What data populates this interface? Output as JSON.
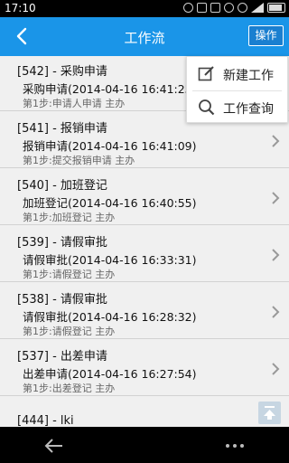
{
  "status_bar": {
    "time": "17:10"
  },
  "header": {
    "title": "工作流",
    "action_label": "操作"
  },
  "menu": {
    "items": [
      {
        "label": "新建工作",
        "icon": "edit-icon"
      },
      {
        "label": "工作查询",
        "icon": "search-icon"
      }
    ]
  },
  "list": {
    "items": [
      {
        "title": "[542]  -  采购申请",
        "subtitle": "采购申请(2014-04-16 16:41:25)",
        "step": "第1步:申请人申请 主办"
      },
      {
        "title": "[541]  -  报销申请",
        "subtitle": "报销申请(2014-04-16 16:41:09)",
        "step": "第1步:提交报销申请 主办"
      },
      {
        "title": "[540]  -  加班登记",
        "subtitle": "加班登记(2014-04-16 16:40:55)",
        "step": "第1步:加班登记 主办"
      },
      {
        "title": "[539]  -  请假审批",
        "subtitle": "请假审批(2014-04-16 16:33:31)",
        "step": "第1步:请假登记 主办"
      },
      {
        "title": "[538]  -  请假审批",
        "subtitle": "请假审批(2014-04-16 16:28:32)",
        "step": "第1步:请假登记 主办"
      },
      {
        "title": "[537]  -  出差申请",
        "subtitle": "出差申请(2014-04-16 16:27:54)",
        "step": "第1步:出差登记 主办"
      },
      {
        "title": "[444]  -  lki",
        "subtitle": "",
        "step": ""
      }
    ]
  },
  "colors": {
    "title_bar": "#1a95e8",
    "background": "#f0f0f0",
    "separator": "#d2d2d2"
  }
}
